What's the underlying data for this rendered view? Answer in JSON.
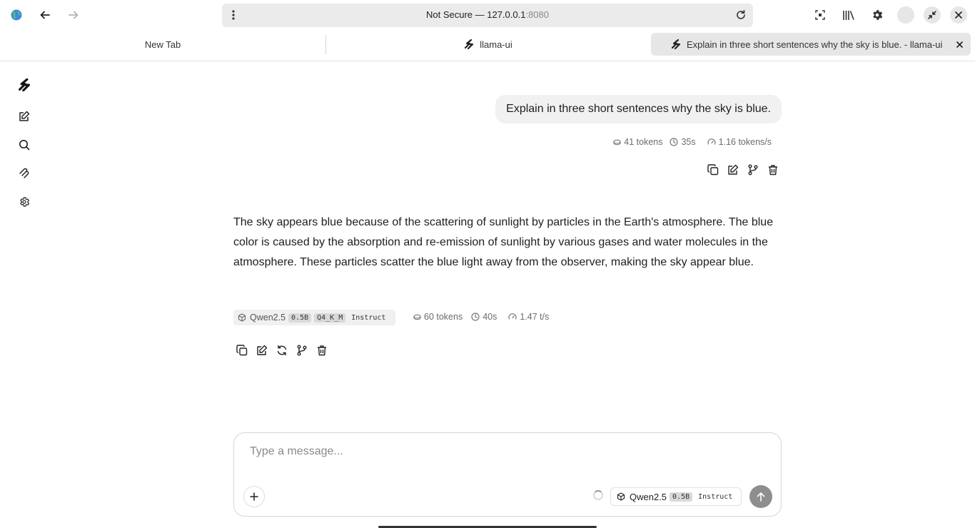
{
  "browser": {
    "url_prefix": "Not Secure — 127.0.0.1",
    "url_port": ":8080"
  },
  "tabs": [
    {
      "label": "New Tab"
    },
    {
      "label": "llama-ui"
    },
    {
      "label": "Explain in three short sentences why the sky is blue. - llama-ui"
    }
  ],
  "sidebar": {
    "items": [
      "logo-icon",
      "new-chat-icon",
      "search-icon",
      "mcp-icon",
      "settings-icon"
    ]
  },
  "user_message": {
    "text": "Explain in three short sentences why the sky is blue.",
    "tokens": "41 tokens",
    "time": "35s",
    "speed": "1.16 tokens/s"
  },
  "assistant_message": {
    "text": "The sky appears blue because of the scattering of sunlight by particles in the Earth's atmosphere. The blue color is caused by the absorption and re-emission of sunlight by various gases and water molecules in the atmosphere. These particles scatter the blue light away from the observer, making the sky appear blue.",
    "model": "Qwen2.5",
    "model_size": "0.5B",
    "quant": "Q4_K_M",
    "variant": "Instruct",
    "tokens": "60 tokens",
    "time": "40s",
    "speed": "1.47 t/s"
  },
  "composer": {
    "placeholder": "Type a message...",
    "model": "Qwen2.5",
    "model_size": "0.5B",
    "variant": "Instruct"
  },
  "colors": {
    "send_button": "#8e8e8e",
    "bubble_bg": "#f1f1f1"
  }
}
